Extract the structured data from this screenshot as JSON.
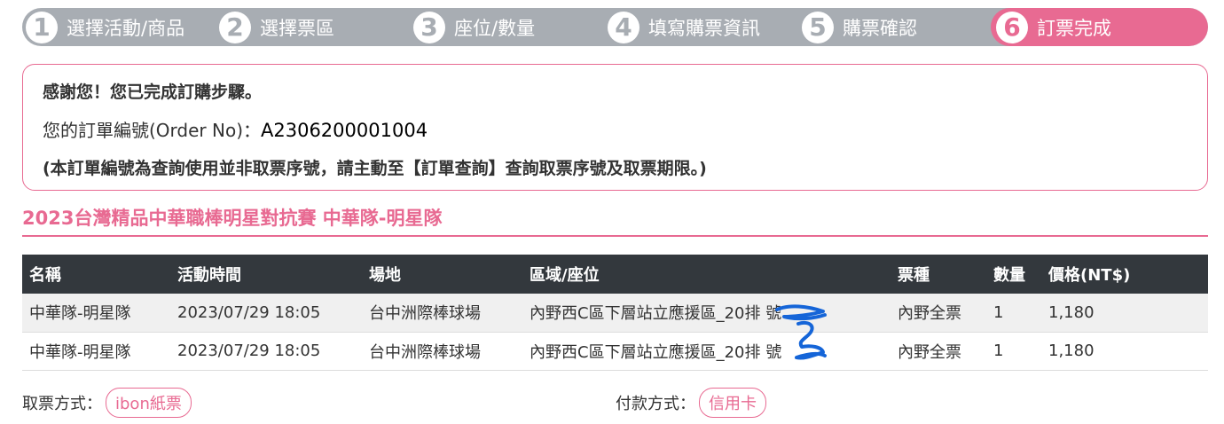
{
  "steps": [
    {
      "num": "1",
      "label": "選擇活動/商品"
    },
    {
      "num": "2",
      "label": "選擇票區"
    },
    {
      "num": "3",
      "label": "座位/數量"
    },
    {
      "num": "4",
      "label": "填寫購票資訊"
    },
    {
      "num": "5",
      "label": "購票確認"
    },
    {
      "num": "6",
      "label": "訂票完成"
    }
  ],
  "thanks": {
    "line1": "感謝您！您已完成訂購步驟。",
    "order_prefix": "您的訂單編號(Order  No)：",
    "order_no": "A2306200001004",
    "line3": "(本訂單編號為查詢使用並非取票序號，請主動至【訂單查詢】查詢取票序號及取票期限。)"
  },
  "event_title": "2023台灣精品中華職棒明星對抗賽  中華隊-明星隊",
  "table": {
    "headers": [
      "名稱",
      "活動時間",
      "場地",
      "區域/座位",
      "票種",
      "數量",
      "價格(NT$)"
    ],
    "rows": [
      [
        "中華隊-明星隊",
        "2023/07/29  18:05",
        "台中洲際棒球場",
        "內野西C區下層站立應援區_20排  號",
        "內野全票",
        "1",
        "1,180"
      ],
      [
        "中華隊-明星隊",
        "2023/07/29  18:05",
        "台中洲際棒球場",
        "內野西C區下層站立應援區_20排  號",
        "內野全票",
        "1",
        "1,180"
      ]
    ]
  },
  "pickup": {
    "label": "取票方式：",
    "value": "ibon紙票"
  },
  "payment": {
    "label": "付款方式：",
    "value": "信用卡"
  },
  "colors": {
    "accent": "#e86a92",
    "step_gray": "#a8adb3",
    "header_dark": "#33383d"
  }
}
